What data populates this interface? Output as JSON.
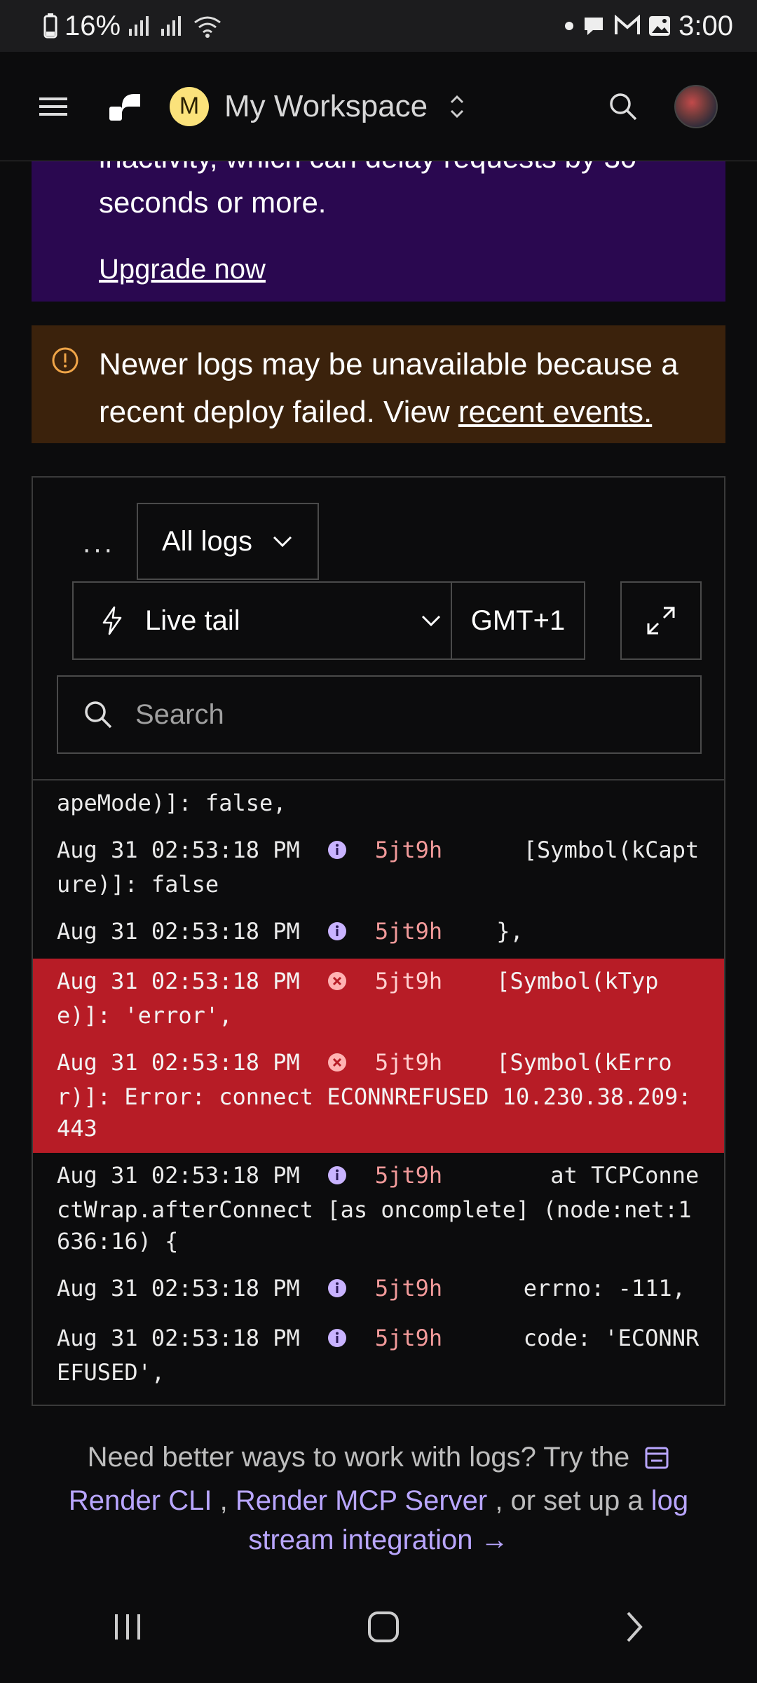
{
  "status_bar": {
    "battery": "16%",
    "time": "3:00"
  },
  "header": {
    "workspace_initial": "M",
    "workspace_name": "My Workspace"
  },
  "banner": {
    "partial_line": "inactivity, which can delay requests by 30",
    "line": "seconds or more.",
    "upgrade_link": "Upgrade now"
  },
  "warning": {
    "text": "Newer logs may be unavailable because a recent deploy failed. View ",
    "link": "recent events."
  },
  "toolbar": {
    "more_label": "···",
    "logs_filter": "All logs",
    "live_tail": "Live tail",
    "timezone": "GMT+1"
  },
  "search": {
    "placeholder": "Search"
  },
  "logs": [
    {
      "timestamp": "",
      "level": "",
      "instance": "",
      "message": "apeMode)]: false,"
    },
    {
      "timestamp": "Aug 31 02:53:18 PM",
      "level": "info",
      "instance": "5jt9h",
      "message": "      [Symbol(kCapture)]: false"
    },
    {
      "timestamp": "Aug 31 02:53:18 PM",
      "level": "info",
      "instance": "5jt9h",
      "message": "    },"
    },
    {
      "timestamp": "Aug 31 02:53:18 PM",
      "level": "error",
      "instance": "5jt9h",
      "message": "    [Symbol(kType)]: 'error',"
    },
    {
      "timestamp": "Aug 31 02:53:18 PM",
      "level": "error",
      "instance": "5jt9h",
      "message": "    [Symbol(kError)]: Error: connect ECONNREFUSED 10.230.38.209:443"
    },
    {
      "timestamp": "Aug 31 02:53:18 PM",
      "level": "info",
      "instance": "5jt9h",
      "message": "        at TCPConnectWrap.afterConnect [as oncomplete] (node:net:1636:16) {"
    },
    {
      "timestamp": "Aug 31 02:53:18 PM",
      "level": "info",
      "instance": "5jt9h",
      "message": "      errno: -111,"
    },
    {
      "timestamp": "Aug 31 02:53:18 PM",
      "level": "info",
      "instance": "5jt9h",
      "message": "      code: 'ECONNREFUSED',"
    }
  ],
  "footer": {
    "text_1": "Need better ways to work with logs? Try the",
    "link_cli": "Render CLI",
    "sep": " , ",
    "link_mcp": "Render MCP Server",
    "text_2": " , or set up a ",
    "link_stream": "log stream integration →"
  },
  "colors": {
    "error_row": "#b71c26",
    "link": "#b9a6ff",
    "banner": "#2a0850",
    "warning": "#3b220c"
  }
}
